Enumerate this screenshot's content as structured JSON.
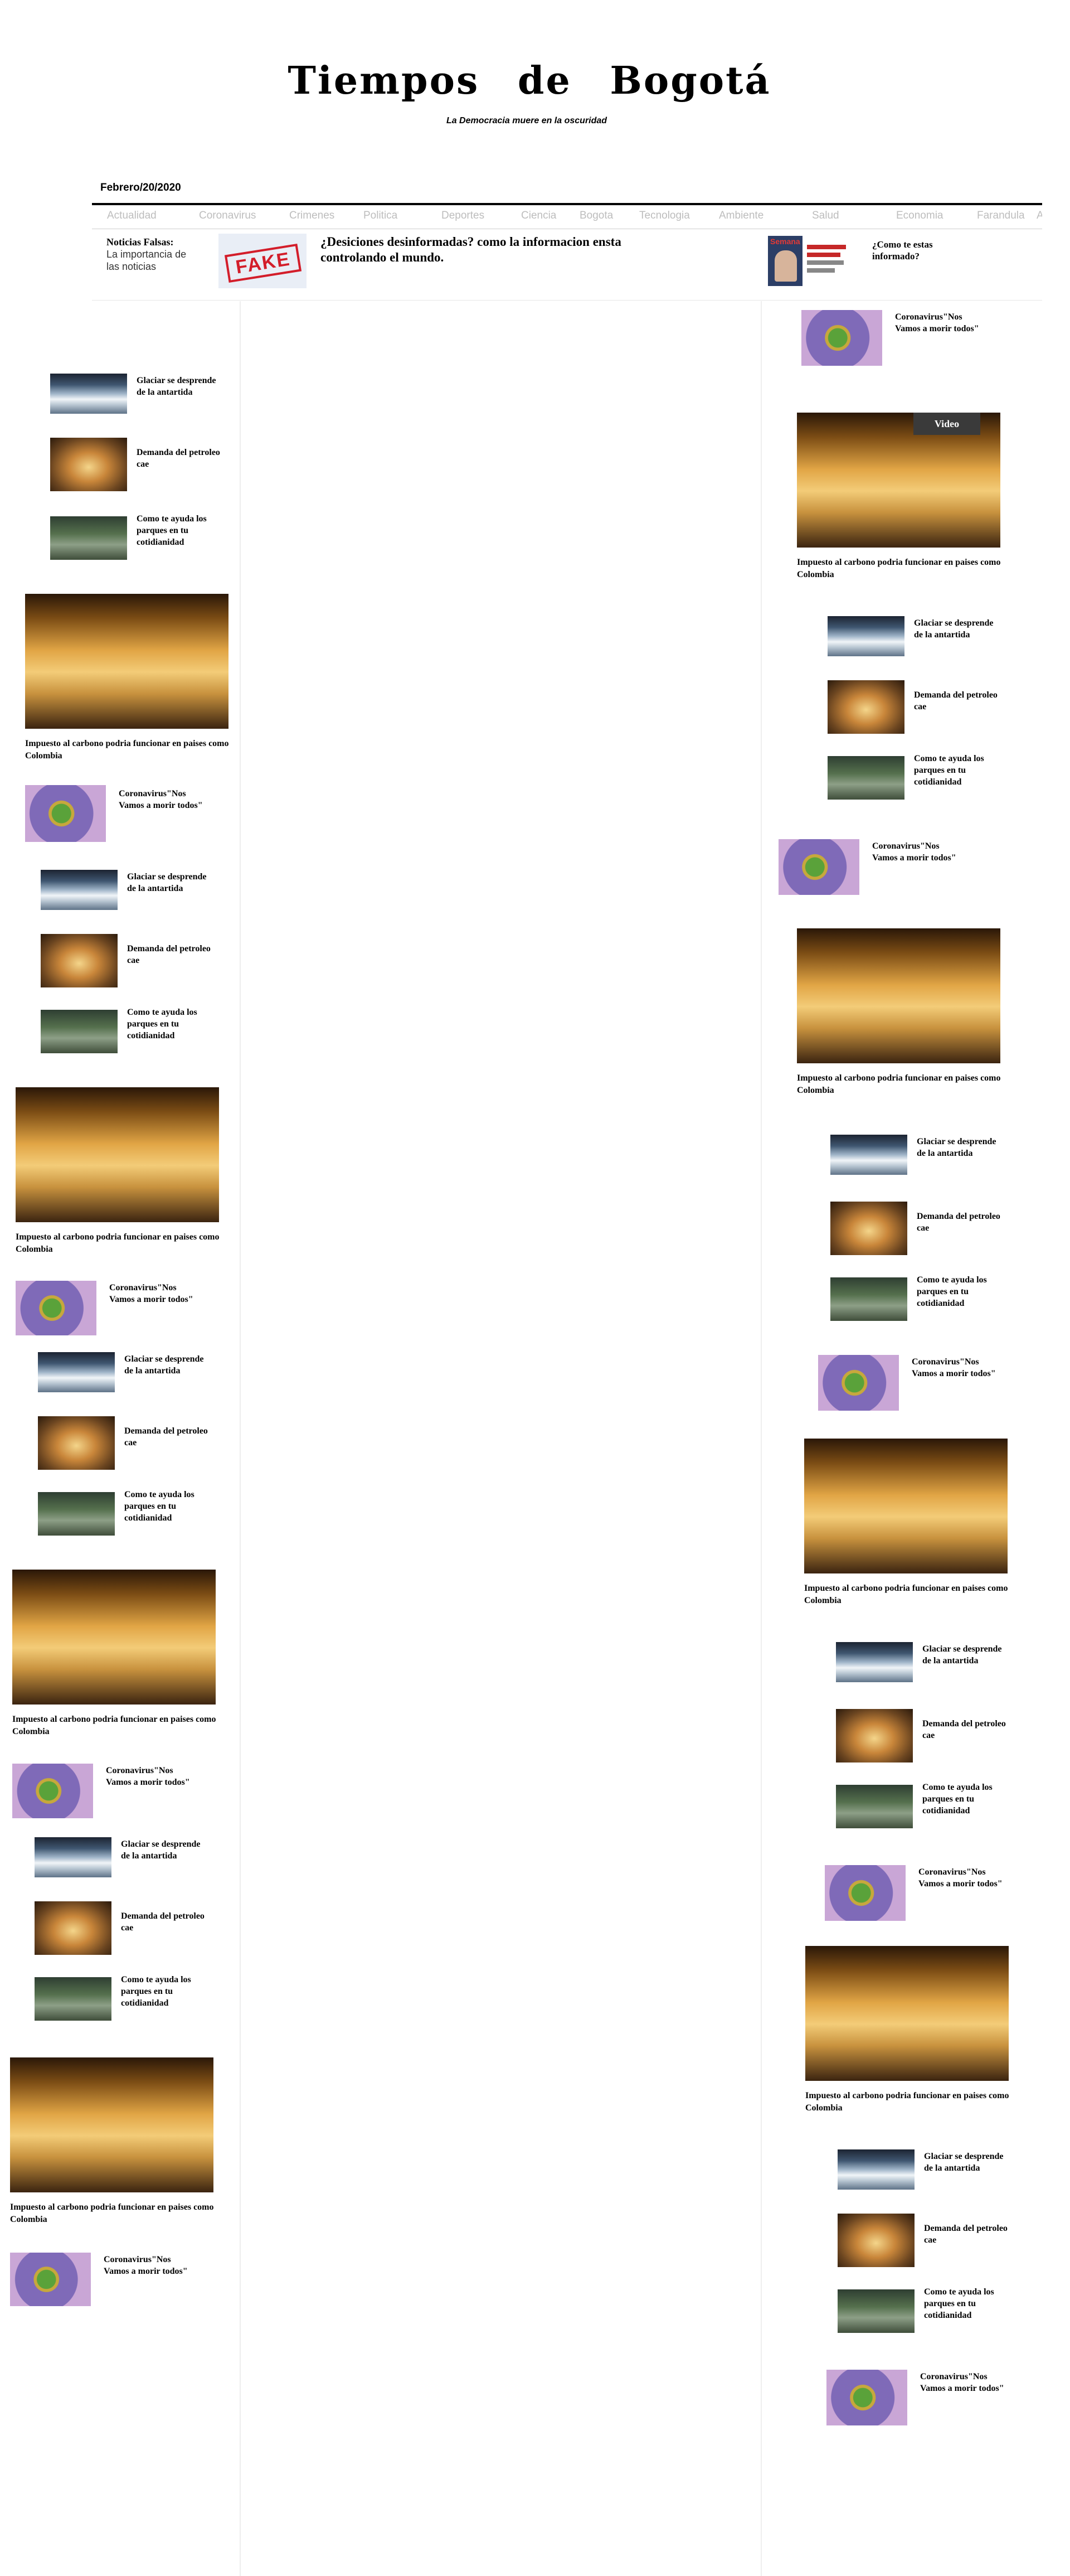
{
  "masthead": {
    "title": "Tiempos de Bogotá",
    "tagline": "La Democracia muere en la oscuridad",
    "date": "Febrero/20/2020"
  },
  "nav": {
    "items": [
      "Actualidad",
      "Coronavirus",
      "Crimenes",
      "Politica",
      "Deportes",
      "Ciencia",
      "Bogota",
      "Tecnologia",
      "Ambiente",
      "Salud",
      "Economia",
      "Farandula",
      "A"
    ]
  },
  "ticker": {
    "left_bold": "Noticias Falsas:",
    "left_text": "La importancia de las noticias",
    "fake_stamp": "FAKE",
    "main_headline": "¿Desiciones desinformadas? como la informacion ensta controlando el mundo.",
    "semana_label": "Semana",
    "side_headline": "¿Como te estas informado?"
  },
  "articles": {
    "glacier": "Glaciar se desprende de la antartida",
    "oil": "Demanda del petroleo cae",
    "parks": "Como te ayuda los parques en tu cotidianidad",
    "carbon": "Impuesto al carbono podria funcionar en paises como Colombia",
    "corona": "Coronavirus\"Nos Vamos a morir todos\"",
    "video_label": "Video"
  },
  "colors": {
    "nav_text": "#bdbdbd",
    "rule": "#000000",
    "fake_red": "#d31d2a"
  }
}
